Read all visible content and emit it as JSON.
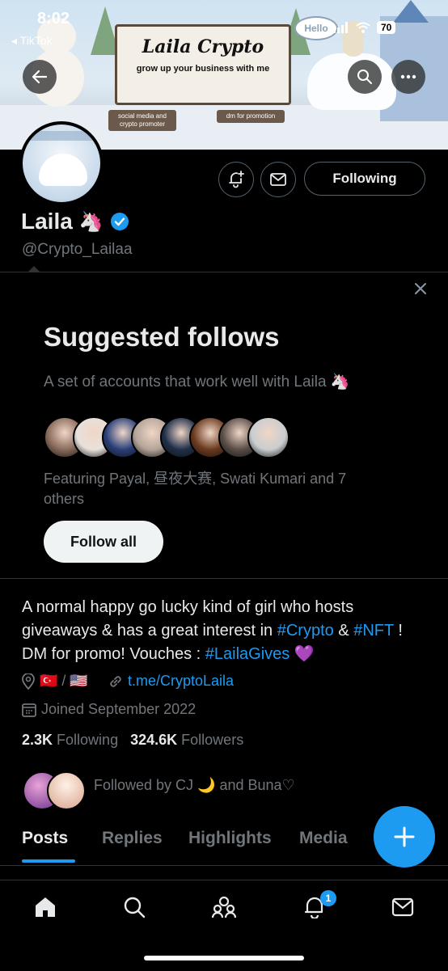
{
  "status_bar": {
    "time": "8:02",
    "back_app": "◂ TikTok",
    "battery": "70"
  },
  "banner": {
    "sign_title": "Laila Crypto",
    "sign_subtitle": "grow up your business with me",
    "left_post": "social media and crypto promoter",
    "right_post": "dm for promotion",
    "hello_text": "Hello"
  },
  "profile": {
    "name": "Laila",
    "name_emoji": "🦄",
    "handle": "@Crypto_Lailaa",
    "following_button": "Following",
    "verified_color": "#1d9bf0"
  },
  "suggested": {
    "title": "Suggested follows",
    "subtitle": "A set of accounts that work well with Laila 🦄",
    "featuring": "Featuring Payal, 昼夜大赛, Swati Kumari and 7 others",
    "follow_all": "Follow all",
    "avatar_colors": [
      "#8a6b5c",
      "#e9e1dc",
      "#2a3f7a",
      "#b4a49a",
      "#1f2f4a",
      "#6b3a1f",
      "#5a4e48",
      "#c9cdd0"
    ]
  },
  "bio": {
    "line1": "A normal happy go lucky kind of girl who hosts giveaways & has a great interest in ",
    "tag1": "#Crypto",
    "amp": " & ",
    "tag2": "#NFT",
    "line2": " ! DM for promo! Vouches : ",
    "tag3": "#LailaGives",
    "heart": " 💜",
    "location": "🇹🇷 / 🇺🇸",
    "website": "t.me/CryptoLaila",
    "joined": "Joined September 2022"
  },
  "counts": {
    "following_num": "2.3K",
    "following_label": "Following",
    "followers_num": "324.6K",
    "followers_label": "Followers"
  },
  "followed_by": "Followed by CJ 🌙 and Buna♡",
  "tabs": [
    {
      "label": "Posts"
    },
    {
      "label": "Replies"
    },
    {
      "label": "Highlights"
    },
    {
      "label": "Media"
    }
  ],
  "nav": {
    "notification_count": "1"
  },
  "accent": "#1d9bf0"
}
